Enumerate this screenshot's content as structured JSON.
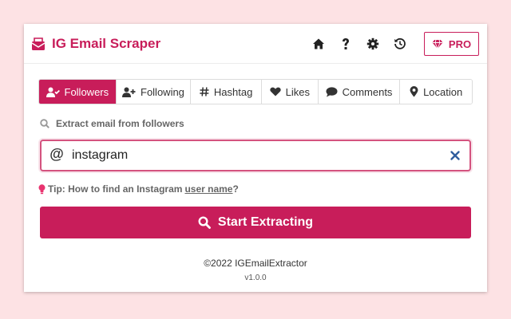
{
  "colors": {
    "accent": "#c81d5a",
    "background": "#fde2e4"
  },
  "header": {
    "title": "IG Email Scraper",
    "icons": [
      "home-icon",
      "help-icon",
      "gear-icon",
      "history-icon"
    ],
    "pro_label": "PRO"
  },
  "tabs": [
    {
      "label": "Followers",
      "icon": "user-check-icon",
      "active": true
    },
    {
      "label": "Following",
      "icon": "user-plus-icon",
      "active": false
    },
    {
      "label": "Hashtag",
      "icon": "hashtag-icon",
      "active": false
    },
    {
      "label": "Likes",
      "icon": "heart-icon",
      "active": false
    },
    {
      "label": "Comments",
      "icon": "comment-icon",
      "active": false
    },
    {
      "label": "Location",
      "icon": "location-pin-icon",
      "active": false
    }
  ],
  "search": {
    "subtitle": "Extract email from followers",
    "at_symbol": "@",
    "value": "instagram"
  },
  "tip": {
    "prefix": "Tip: How to find an Instagram",
    "link": "user name",
    "suffix": "?"
  },
  "start_button": {
    "label": "Start Extracting"
  },
  "footer": {
    "copyright": "©2022 IGEmailExtractor",
    "version": "v1.0.0"
  }
}
